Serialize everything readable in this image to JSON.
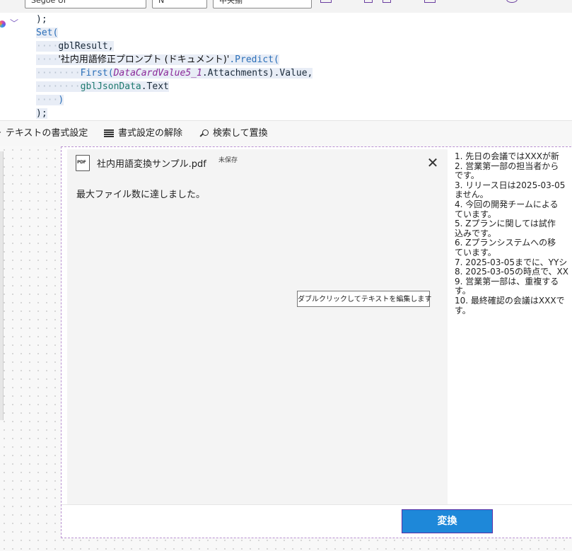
{
  "topbar": {
    "field1": "Segoe UI",
    "field2": "N",
    "field3": "中央揃"
  },
  "code": {
    "line0": ");",
    "line1": "Set(",
    "line2_var": "gblResult,",
    "line3_str": "'社内用語修正プロンプト (ドキュメント)'",
    "line3_fn": ".Predict(",
    "line4_fn": "First(",
    "line4_it": "DataCardValue5_1",
    "line4_rest": ".Attachments).Value,",
    "line5_var": "gblJsonData",
    "line5_rest": ".Text",
    "line6": ")",
    "line7": ");"
  },
  "format_toolbar": {
    "format_text": "テキストの書式設定",
    "remove_format": "書式設定の解除",
    "find_replace": "検索して置換"
  },
  "attachment": {
    "icon_text": "PDF",
    "file_name": "社内用語変換サンプル.pdf",
    "unsaved_label": "未保存",
    "close_glyph": "✕",
    "max_files_message": "最大ファイル数に達しました。",
    "tooltip": "ダブルクリックしてテキストを編集します"
  },
  "text_output": {
    "lines": [
      "1. 先日の会議ではXXXが新",
      "2. 営業第一部の担当者から",
      "です。",
      "3. リリース日は2025-03-05",
      "ません。",
      "4. 今回の開発チームによる",
      "ています。",
      "5. Zプランに関しては試作",
      "込みです。",
      "6. Zプランシステムへの移",
      "ています。",
      "7. 2025-03-05までに、YYシ",
      "8. 2025-03-05の時点で、XX",
      "9. 営業第一部は、重複する",
      "す。",
      "10. 最終確認の会議はXXXで",
      "す。"
    ]
  },
  "convert_button": {
    "label": "変換"
  }
}
